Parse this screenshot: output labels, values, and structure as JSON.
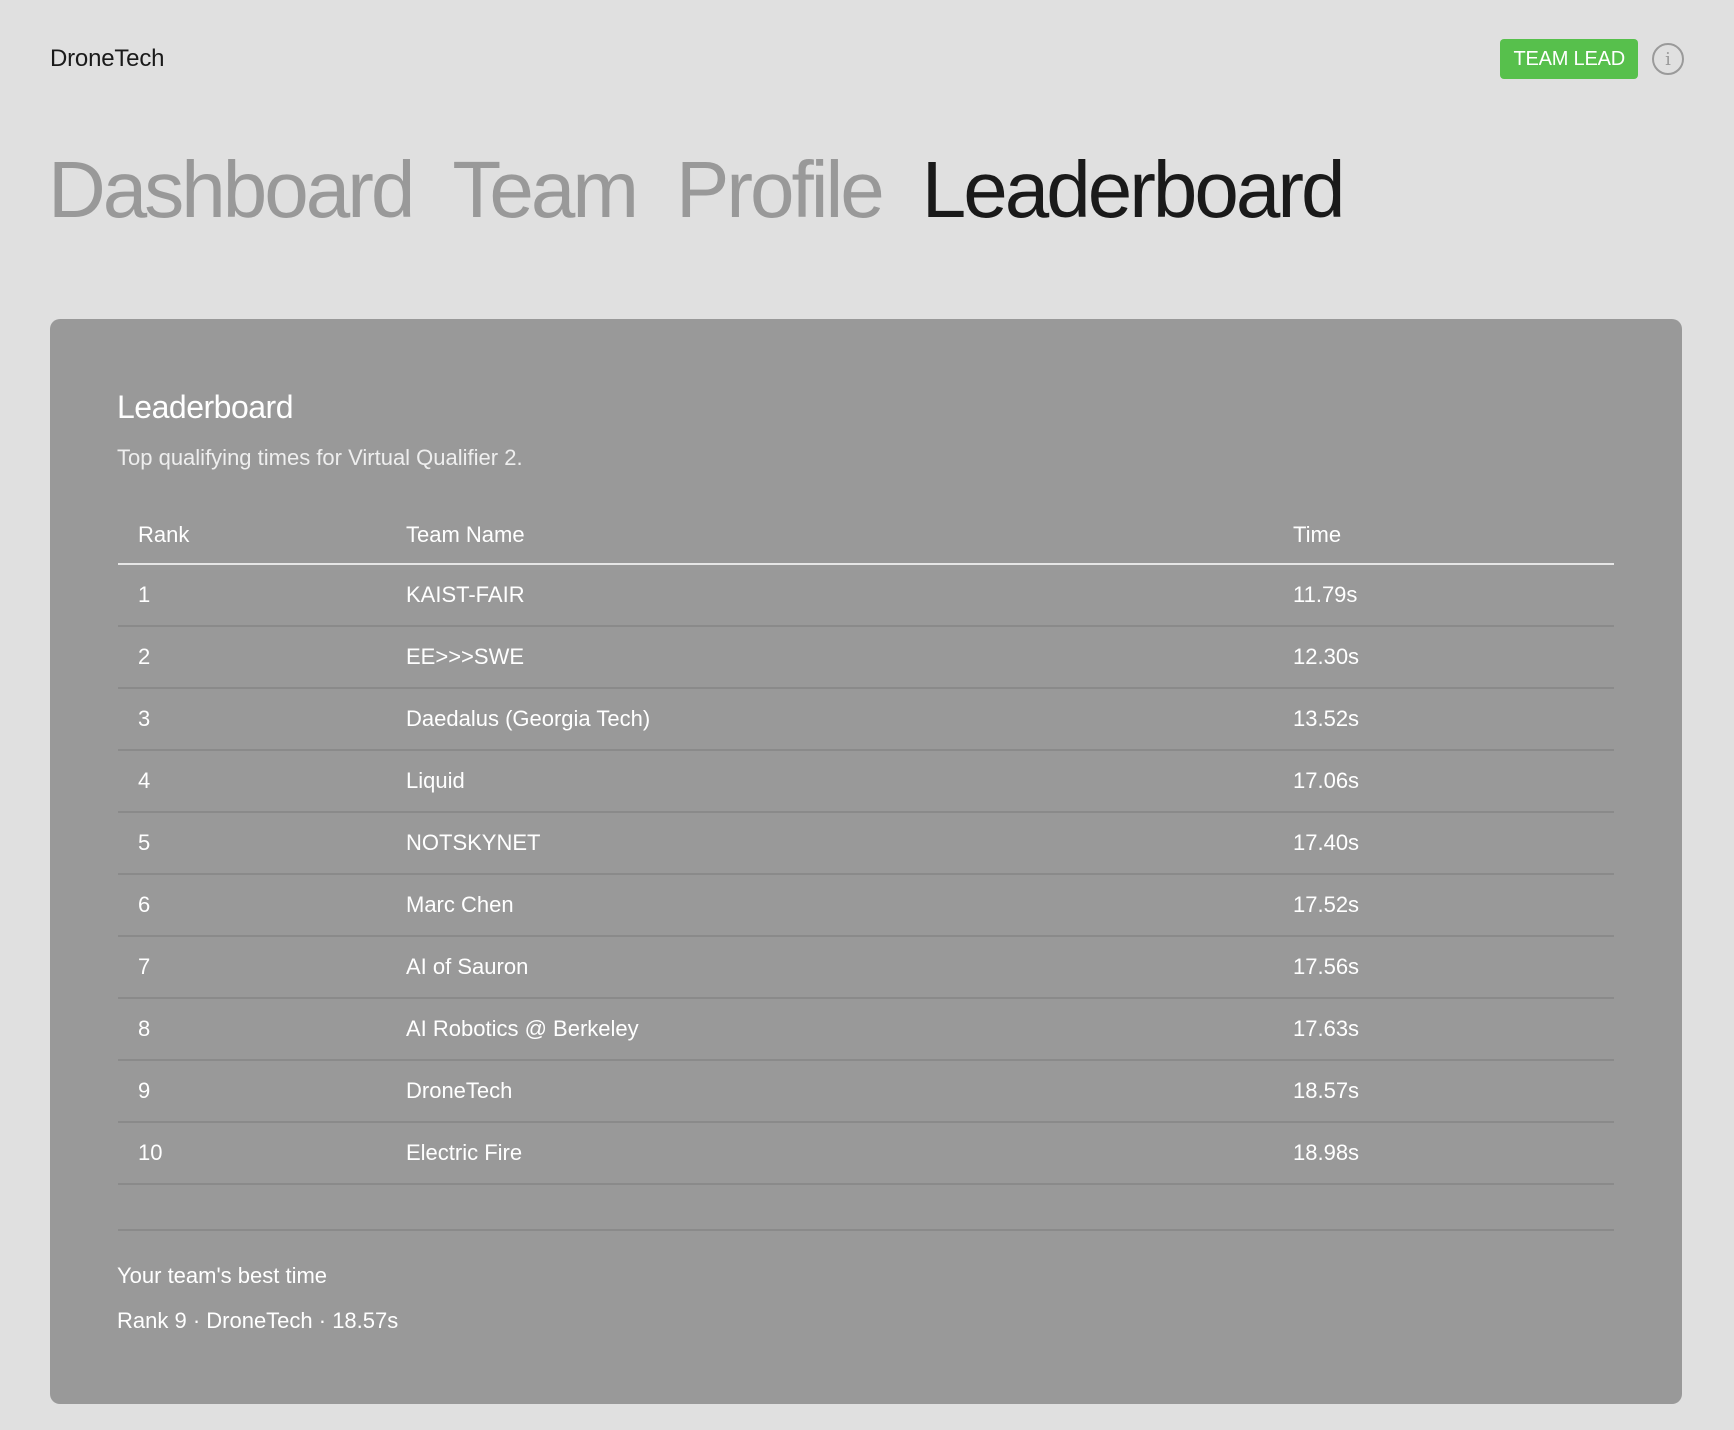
{
  "brand": "DroneTech",
  "role_badge": "TEAM LEAD",
  "info_icon": "i",
  "nav": [
    {
      "label": "Dashboard",
      "active": false
    },
    {
      "label": "Team",
      "active": false
    },
    {
      "label": "Profile",
      "active": false
    },
    {
      "label": "Leaderboard",
      "active": true
    }
  ],
  "panel": {
    "title": "Leaderboard",
    "subtitle": "Top qualifying times for Virtual Qualifier 2.",
    "columns": [
      "Rank",
      "Team Name",
      "Time"
    ],
    "rows": [
      {
        "rank": "1",
        "team": "KAIST-FAIR",
        "time": "11.79s"
      },
      {
        "rank": "2",
        "team": "EE>>>SWE",
        "time": "12.30s"
      },
      {
        "rank": "3",
        "team": "Daedalus (Georgia Tech)",
        "time": "13.52s"
      },
      {
        "rank": "4",
        "team": "Liquid",
        "time": "17.06s"
      },
      {
        "rank": "5",
        "team": "NOTSKYNET",
        "time": "17.40s"
      },
      {
        "rank": "6",
        "team": "Marc Chen",
        "time": "17.52s"
      },
      {
        "rank": "7",
        "team": "AI of Sauron",
        "time": "17.56s"
      },
      {
        "rank": "8",
        "team": "AI Robotics @ Berkeley",
        "time": "17.63s"
      },
      {
        "rank": "9",
        "team": "DroneTech",
        "time": "18.57s"
      },
      {
        "rank": "10",
        "team": "Electric Fire",
        "time": "18.98s"
      }
    ],
    "best_label": "Your team's best time",
    "best_value": "Rank 9 · DroneTech · 18.57s"
  },
  "colors": {
    "page_bg": "#e0e0e0",
    "panel_bg": "#999999",
    "badge_green": "#57c04c",
    "nav_inactive": "#999999",
    "nav_active": "#1a1a1a"
  },
  "icons": {
    "info": "info-icon"
  }
}
